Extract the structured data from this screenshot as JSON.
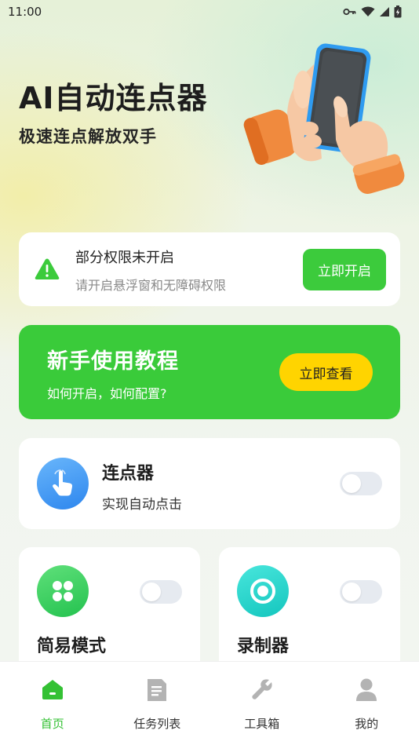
{
  "status_bar": {
    "time": "11:00"
  },
  "hero": {
    "title": "AI自动连点器",
    "subtitle": "极速连点解放双手"
  },
  "permission_card": {
    "title": "部分权限未开启",
    "description": "请开启悬浮窗和无障碍权限",
    "button_label": "立即开启"
  },
  "tutorial_card": {
    "title": "新手使用教程",
    "description": "如何开启，如何配置?",
    "button_label": "立即查看"
  },
  "clicker_card": {
    "title": "连点器",
    "description": "实现自动点击",
    "toggle_on": false
  },
  "mode_cards": [
    {
      "title": "简易模式",
      "icon": "clover-icon",
      "toggle_on": false
    },
    {
      "title": "录制器",
      "icon": "record-icon",
      "toggle_on": false
    }
  ],
  "tabbar": {
    "items": [
      {
        "label": "首页",
        "icon": "home-icon",
        "active": true
      },
      {
        "label": "任务列表",
        "icon": "document-icon",
        "active": false
      },
      {
        "label": "工具箱",
        "icon": "wrench-icon",
        "active": false
      },
      {
        "label": "我的",
        "icon": "person-icon",
        "active": false
      }
    ]
  },
  "colors": {
    "primary_green": "#3ccb3c",
    "accent_yellow": "#ffd400",
    "clicker_blue": "#2d86ee",
    "record_cyan": "#14c6be"
  }
}
